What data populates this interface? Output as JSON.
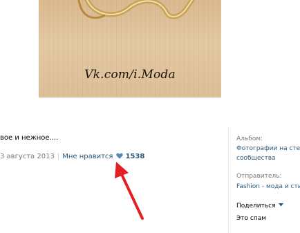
{
  "photo": {
    "watermark": "Vk.com/i.Moda"
  },
  "post": {
    "caption": "вое и нежное....",
    "date": "3 августа 2013",
    "separator": "|",
    "like_label": "Мне нравится",
    "likes_count": "1538"
  },
  "sidebar": {
    "album_label": "Альбом:",
    "album_line1": "Фотографии на сте",
    "album_line2": "сообщества",
    "sender_label": "Отправитель:",
    "sender_value": "Fashion - мода и сти",
    "share_label": "Поделиться",
    "spam_label": "Это спам"
  },
  "colors": {
    "link": "#2b587a",
    "muted": "#777777",
    "arrow": "#e41f23",
    "heart": "#5b88b0"
  },
  "icons": {
    "heart": "heart-icon",
    "chevron": "chevron-down-icon",
    "arrow": "red-arrow-annotation"
  }
}
